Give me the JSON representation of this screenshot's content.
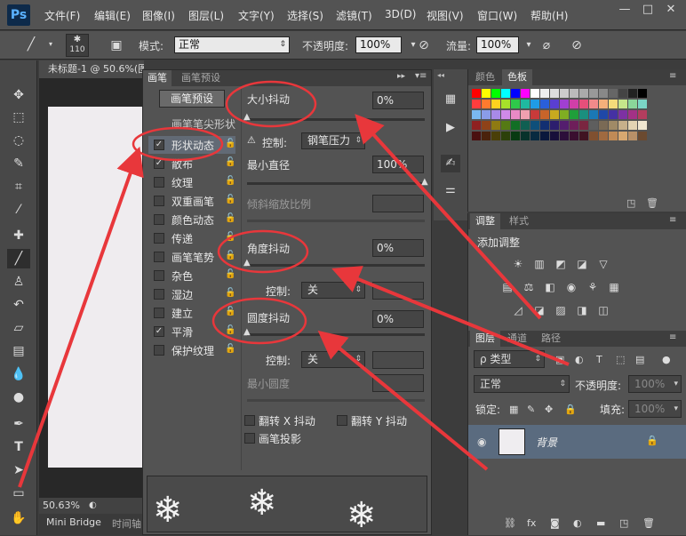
{
  "app": {
    "logo": "Ps"
  },
  "menu": [
    "文件(F)",
    "编辑(E)",
    "图像(I)",
    "图层(L)",
    "文字(Y)",
    "选择(S)",
    "滤镜(T)",
    "3D(D)",
    "视图(V)",
    "窗口(W)",
    "帮助(H)"
  ],
  "window_controls": {
    "minimize": "—",
    "restore": "□",
    "close": "✕"
  },
  "options": {
    "brush_size": "110",
    "mode_label": "模式:",
    "mode_value": "正常",
    "opacity_label": "不透明度:",
    "opacity_value": "100%",
    "flow_label": "流量:",
    "flow_value": "100%"
  },
  "document": {
    "tab_title": "未标题-1 @ 50.6%(图层 1",
    "zoom": "50.63%",
    "bottom_tabs": [
      "Mini Bridge",
      "时间轴"
    ]
  },
  "brush_panel": {
    "tabs": [
      "画笔",
      "画笔预设"
    ],
    "preset_button": "画笔预设",
    "tip_shape": "画笔笔尖形状",
    "items": [
      {
        "label": "形状动态",
        "checked": true,
        "selected": true
      },
      {
        "label": "散布",
        "checked": true
      },
      {
        "label": "纹理",
        "checked": false
      },
      {
        "label": "双重画笔",
        "checked": false
      },
      {
        "label": "颜色动态",
        "checked": false
      },
      {
        "label": "传递",
        "checked": false
      },
      {
        "label": "画笔笔势",
        "checked": false
      },
      {
        "label": "杂色",
        "checked": false
      },
      {
        "label": "湿边",
        "checked": false
      },
      {
        "label": "建立",
        "checked": false
      },
      {
        "label": "平滑",
        "checked": true
      },
      {
        "label": "保护纹理",
        "checked": false
      }
    ],
    "size_jitter": {
      "label": "大小抖动",
      "value": "0%"
    },
    "control_label": "控制:",
    "size_control_value": "钢笔压力",
    "min_diameter": {
      "label": "最小直径",
      "value": "100%"
    },
    "tilt_scale": {
      "label": "倾斜缩放比例"
    },
    "angle_jitter": {
      "label": "角度抖动",
      "value": "0%"
    },
    "angle_control_value": "关",
    "roundness_jitter": {
      "label": "圆度抖动",
      "value": "0%"
    },
    "roundness_control_value": "关",
    "min_roundness": {
      "label": "最小圆度"
    },
    "flip_x": "翻转 X 抖动",
    "flip_y": "翻转 Y 抖动",
    "brush_projection": "画笔投影",
    "preview_glyph": "❄"
  },
  "swatches_panel": {
    "tabs": [
      "颜色",
      "色板"
    ],
    "colors": [
      "#ff0000",
      "#ffff00",
      "#00ff00",
      "#00ffff",
      "#0000ff",
      "#ff00ff",
      "#ffffff",
      "#eeeeee",
      "#dddddd",
      "#cccccc",
      "#bbbbbb",
      "#aaaaaa",
      "#999999",
      "#888888",
      "#666666",
      "#444444",
      "#222222",
      "#000000",
      "#ff3d3d",
      "#ff7a2e",
      "#ffd21f",
      "#a7e02a",
      "#2ec94a",
      "#1fb8a0",
      "#1f9be6",
      "#2a5fd9",
      "#5a3fd1",
      "#a03fd1",
      "#d13fa8",
      "#e64f7a",
      "#f28a8a",
      "#f5b07a",
      "#f5dc7a",
      "#c5e58a",
      "#8ad69a",
      "#7ad6c6",
      "#7ab8f0",
      "#8a9ce8",
      "#a88ae8",
      "#d08ae8",
      "#e88ac6",
      "#f0a0b0",
      "#c83a3a",
      "#c8642a",
      "#c8aa1f",
      "#7fae22",
      "#1f9f3a",
      "#1a8f7e",
      "#1a78b5",
      "#1f48a8",
      "#4531a3",
      "#7d31a3",
      "#a33186",
      "#b33d5e",
      "#8f2020",
      "#8f4218",
      "#8f7a12",
      "#557a14",
      "#126f25",
      "#105f52",
      "#0f4f7a",
      "#122f72",
      "#2c1e6e",
      "#541e6e",
      "#6e1e5a",
      "#7a2640",
      "#5e5e5e",
      "#7a6a55",
      "#a08a66",
      "#c7b08a",
      "#e3d3b2",
      "#f0e6d0",
      "#4a1010",
      "#4a220c",
      "#4a3f08",
      "#2c400a",
      "#083a12",
      "#08322b",
      "#082a40",
      "#0a183c",
      "#170f3a",
      "#2c0f3a",
      "#3a0f2f",
      "#401422",
      "#805030",
      "#a06a40",
      "#c08a56",
      "#d8a870",
      "#b89068",
      "#6b4a30"
    ]
  },
  "adjust_panel": {
    "tabs": [
      "调整",
      "样式"
    ],
    "title": "添加调整",
    "row1": [
      "☀",
      "▥",
      "◩",
      "◪",
      "▽"
    ],
    "row2": [
      "▤",
      "⚖",
      "◧",
      "◉",
      "⚘",
      "▦"
    ],
    "row3": [
      "◿",
      "◪",
      "▨",
      "◨",
      "◫"
    ]
  },
  "layers_panel": {
    "tabs": [
      "图层",
      "通道",
      "路径"
    ],
    "filter": "ρ 类型",
    "blend_mode": "正常",
    "opacity_label": "不透明度:",
    "opacity_value": "100%",
    "lock_label": "锁定:",
    "fill_label": "填充:",
    "fill_value": "100%",
    "layer_name": "背景"
  }
}
